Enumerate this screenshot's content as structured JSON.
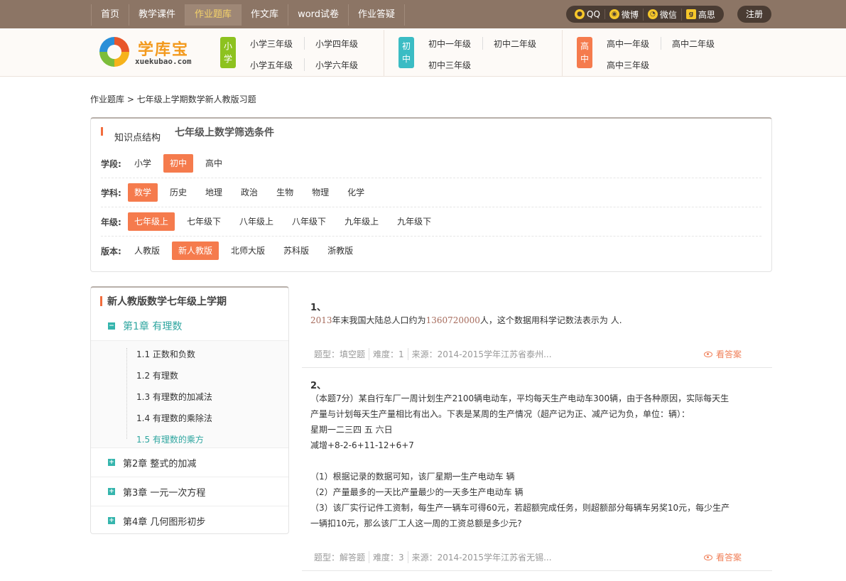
{
  "nav": {
    "items": [
      {
        "label": "首页",
        "active": false
      },
      {
        "label": "教学课件",
        "active": false
      },
      {
        "label": "作业题库",
        "active": true
      },
      {
        "label": "作文库",
        "active": false
      },
      {
        "label": "word试卷",
        "active": false
      },
      {
        "label": "作业答疑",
        "active": false
      }
    ],
    "social": [
      "QQ",
      "微博",
      "微信",
      "高思"
    ],
    "register": "注册"
  },
  "logo": {
    "cn": "学库宝",
    "en": "xuekubao.com"
  },
  "grades": {
    "primary": {
      "tag": "小学",
      "items": [
        "小学三年级",
        "小学四年级",
        "小学五年级",
        "小学六年级"
      ]
    },
    "junior": {
      "tag": "初中",
      "items": [
        "初中一年级",
        "初中二年级",
        "初中三年级"
      ]
    },
    "senior": {
      "tag": "高中",
      "items": [
        "高中一年级",
        "高中二年级",
        "高中三年级"
      ]
    }
  },
  "colors": {
    "primary_tag": "#8dc21f",
    "junior_tag": "#3bbcc4",
    "senior_tag": "#f57b4d",
    "selected": "#f57b4d",
    "accent_teal": "#2fa6a0"
  },
  "breadcrumb": "作业题库 > 七年级上学期数学新人教版习题",
  "filter": {
    "tab1": "知识点结构",
    "tab2": "七年级上数学筛选条件",
    "rows": [
      {
        "label": "学段:",
        "options": [
          "小学",
          "初中",
          "高中"
        ],
        "selected": 1
      },
      {
        "label": "学科:",
        "options": [
          "数学",
          "历史",
          "地理",
          "政治",
          "生物",
          "物理",
          "化学"
        ],
        "selected": 0
      },
      {
        "label": "年级:",
        "options": [
          "七年级上",
          "七年级下",
          "八年级上",
          "八年级下",
          "九年级上",
          "九年级下"
        ],
        "selected": 0
      },
      {
        "label": "版本:",
        "options": [
          "人教版",
          "新人教版",
          "北师大版",
          "苏科版",
          "浙教版"
        ],
        "selected": 1
      }
    ]
  },
  "sidebar": {
    "title": "新人教版数学七年级上学期",
    "chapter1": "第1章 有理数",
    "sections": [
      "1.1 正数和负数",
      "1.2 有理数",
      "1.3 有理数的加减法",
      "1.4 有理数的乘除法",
      "1.5 有理数的乘方"
    ],
    "current_section": 4,
    "chapters": [
      "第2章 整式的加减",
      "第3章 一元一次方程",
      "第4章 几何图形初步"
    ]
  },
  "questions": [
    {
      "num": "1、",
      "text_parts": [
        "",
        "2013",
        "年末我国大陆总人口约为",
        "1360720000",
        "人，这个数据用科学记数法表示为    人."
      ],
      "type": "题型：填空题",
      "difficulty": "难度：1",
      "source": "来源：2014-2015学年江苏省泰州...",
      "answer": "看答案"
    },
    {
      "num": "2、",
      "lines": [
        "（本题7分）某自行车厂一周计划生产2100辆电动车，平均每天生产电动车300辆，由于各种原因，实际每天生",
        "产量与计划每天生产量相比有出入。下表是某周的生产情况（超产记为正、减产记为负，单位：辆）：",
        "星期一二三四  五 六日",
        "减增+8-2-6+11-12+6+7",
        "",
        "（1）根据记录的数据可知，该厂星期一生产电动车          辆",
        "（2）产量最多的一天比产量最少的一天多生产电动车          辆",
        "（3）该厂实行记件工资制，每生产一辆车可得60元，若超额完成任务，则超额部分每辆车另奖10元，每少生产",
        "一辆扣10元，那么该厂工人这一周的工资总额是多少元?"
      ],
      "type": "题型：解答题",
      "difficulty": "难度：3",
      "source": "来源：2014-2015学年江苏省无锡...",
      "answer": "看答案"
    }
  ]
}
